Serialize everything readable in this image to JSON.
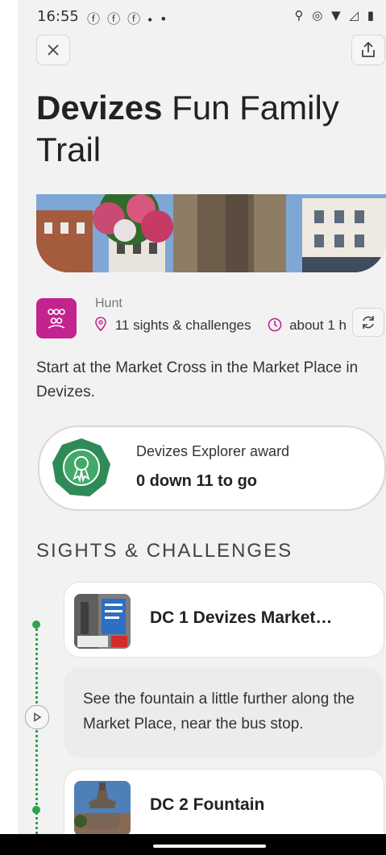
{
  "status_bar": {
    "time": "16:55",
    "left_icons": "ⓕ ⓕ ⓕ ⬩ •",
    "right_icons": "⚲ ◎ ▼ ◿ ▮"
  },
  "title": {
    "bold": "Devizes",
    "rest": " Fun Family Trail"
  },
  "hunt": {
    "label": "Hunt",
    "sights": "11 sights & challenges",
    "duration": "about 1 h"
  },
  "start_text": "Start at the Market Cross in the Market Place in Devizes.",
  "award": {
    "title": "Devizes Explorer award",
    "progress": "0 down 11 to go"
  },
  "section_heading": "SIGHTS & CHALLENGES",
  "stops": [
    {
      "title": "DC 1 Devizes Market…"
    },
    {
      "title": "DC 2 Fountain"
    }
  ],
  "hint": "See the fountain a little further along the Market Place, near the bus stop.",
  "colors": {
    "accent": "#c2238e",
    "trail_green": "#2aa44f",
    "award_green": "#2e8b57"
  },
  "icons": {
    "close": "close-icon",
    "share": "share-icon",
    "hunt": "group-icon",
    "pin": "location-pin-icon",
    "clock": "clock-icon",
    "refresh": "refresh-icon",
    "play": "play-icon",
    "award": "award-ribbon-icon"
  }
}
